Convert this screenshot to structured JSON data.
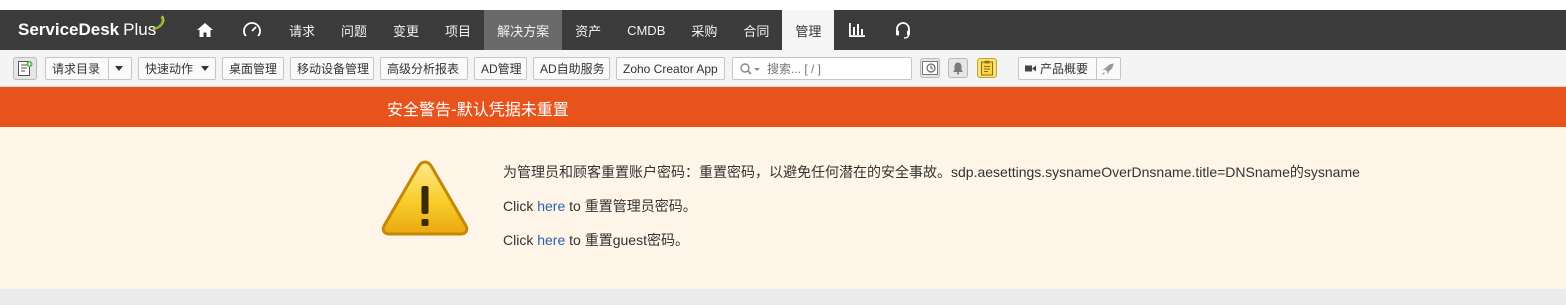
{
  "brand": {
    "name": "ServiceDesk",
    "plus": "Plus"
  },
  "nav": {
    "home_icon": "home-icon",
    "dashboard_icon": "speedometer-icon",
    "items": [
      "请求",
      "问题",
      "变更",
      "项目",
      "解决方案",
      "资产",
      "CMDB",
      "采购",
      "合同",
      "管理"
    ],
    "reports_icon": "bar-chart-icon",
    "support_icon": "headset-icon"
  },
  "toolbar": {
    "new_icon": "new-request-icon",
    "request_catalog": "请求目录",
    "quick_actions": "快速动作",
    "desktop_mgmt": "桌面管理",
    "mobile_device_mgmt": "移动设备管理",
    "advanced_analytics": "高级分析报表",
    "ad_mgmt": "AD管理",
    "ad_self_service": "AD自助服务",
    "zoho_creator": "Zoho Creator App",
    "search_placeholder": "搜索... [ / ]",
    "product_overview": "产品概要"
  },
  "alert": {
    "title": "安全警告-默认凭据未重置",
    "message": "为管理员和顾客重置账户密码：重置密码，以避免任何潜在的安全事故。sdp.aesettings.sysnameOverDnsname.title=DNSname的sysname",
    "click": "Click",
    "here": "here",
    "to": "to",
    "reset_admin": "重置管理员密码。",
    "reset_guest": "重置guest密码。"
  },
  "colors": {
    "nav_bg": "#3b3b3b",
    "alert_orange": "#e8531c",
    "alert_bg": "#fef4e7",
    "link": "#2864b4"
  }
}
